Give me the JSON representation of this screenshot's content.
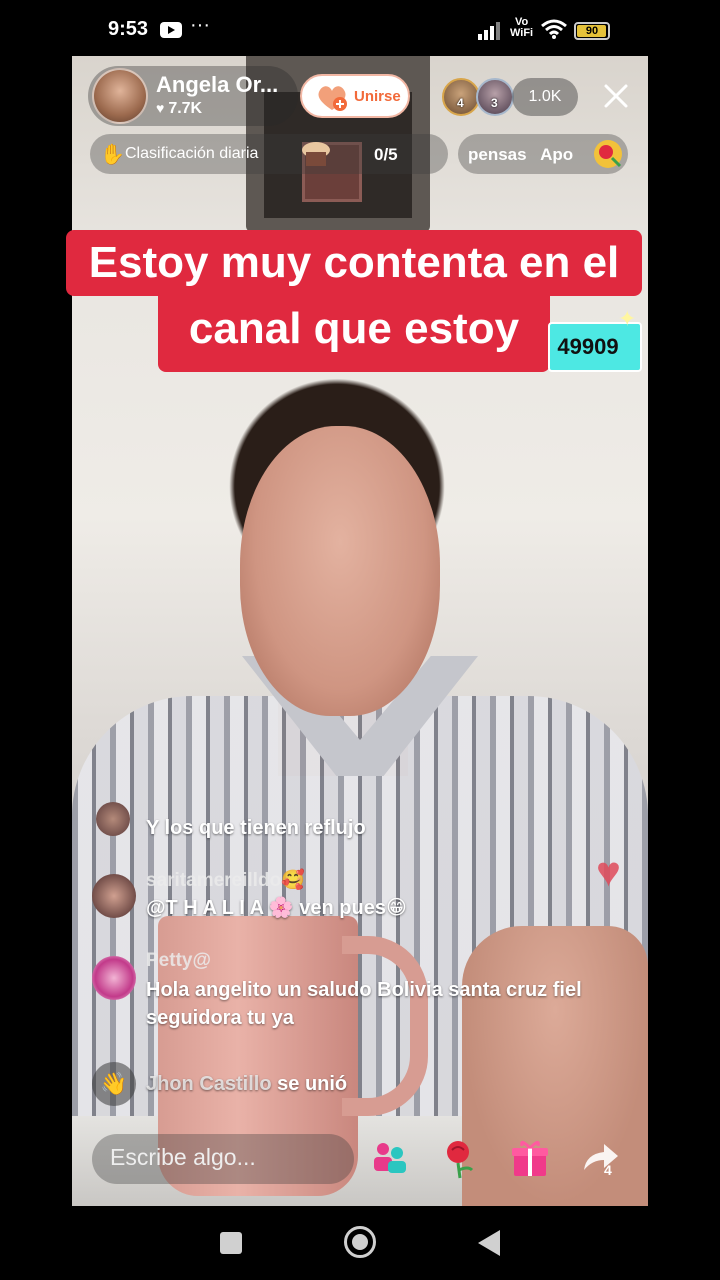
{
  "status_bar": {
    "time": "9:53",
    "dots": "···",
    "vo": "Vo",
    "wifi_label": "WiFi",
    "battery": "90"
  },
  "host": {
    "name": "Angela Or...",
    "likes": "7.7K",
    "join_label": "Unirse"
  },
  "viewers": {
    "ranks": [
      "4",
      "3"
    ],
    "count": "1.0K"
  },
  "ranking": {
    "label": "Clasificación diaria",
    "count": "0/5"
  },
  "promo": {
    "text": "pensas   Apo"
  },
  "caption": {
    "line1": "Estoy muy contenta en el",
    "line2": "canal que estoy"
  },
  "counter": {
    "value": "49909"
  },
  "chat": [
    {
      "user": "",
      "text": "Y los que tienen reflujo"
    },
    {
      "user": "saritamereilldo🥰",
      "text": "@T H A L I A 🌸 ven pues😁"
    },
    {
      "user": "Petty@",
      "text": "Hola angelito un saludo Bolivia santa cruz fiel seguidora tu ya"
    },
    {
      "user": "Jhon Castillo",
      "text": "se unió"
    }
  ],
  "input": {
    "placeholder": "Escribe algo..."
  },
  "actions": {
    "share_count": "4"
  },
  "colors": {
    "caption_bg": "#e0293f",
    "counter_bg": "#4de8e3",
    "join_text": "#f26a3a",
    "battery": "#e5c23a"
  }
}
